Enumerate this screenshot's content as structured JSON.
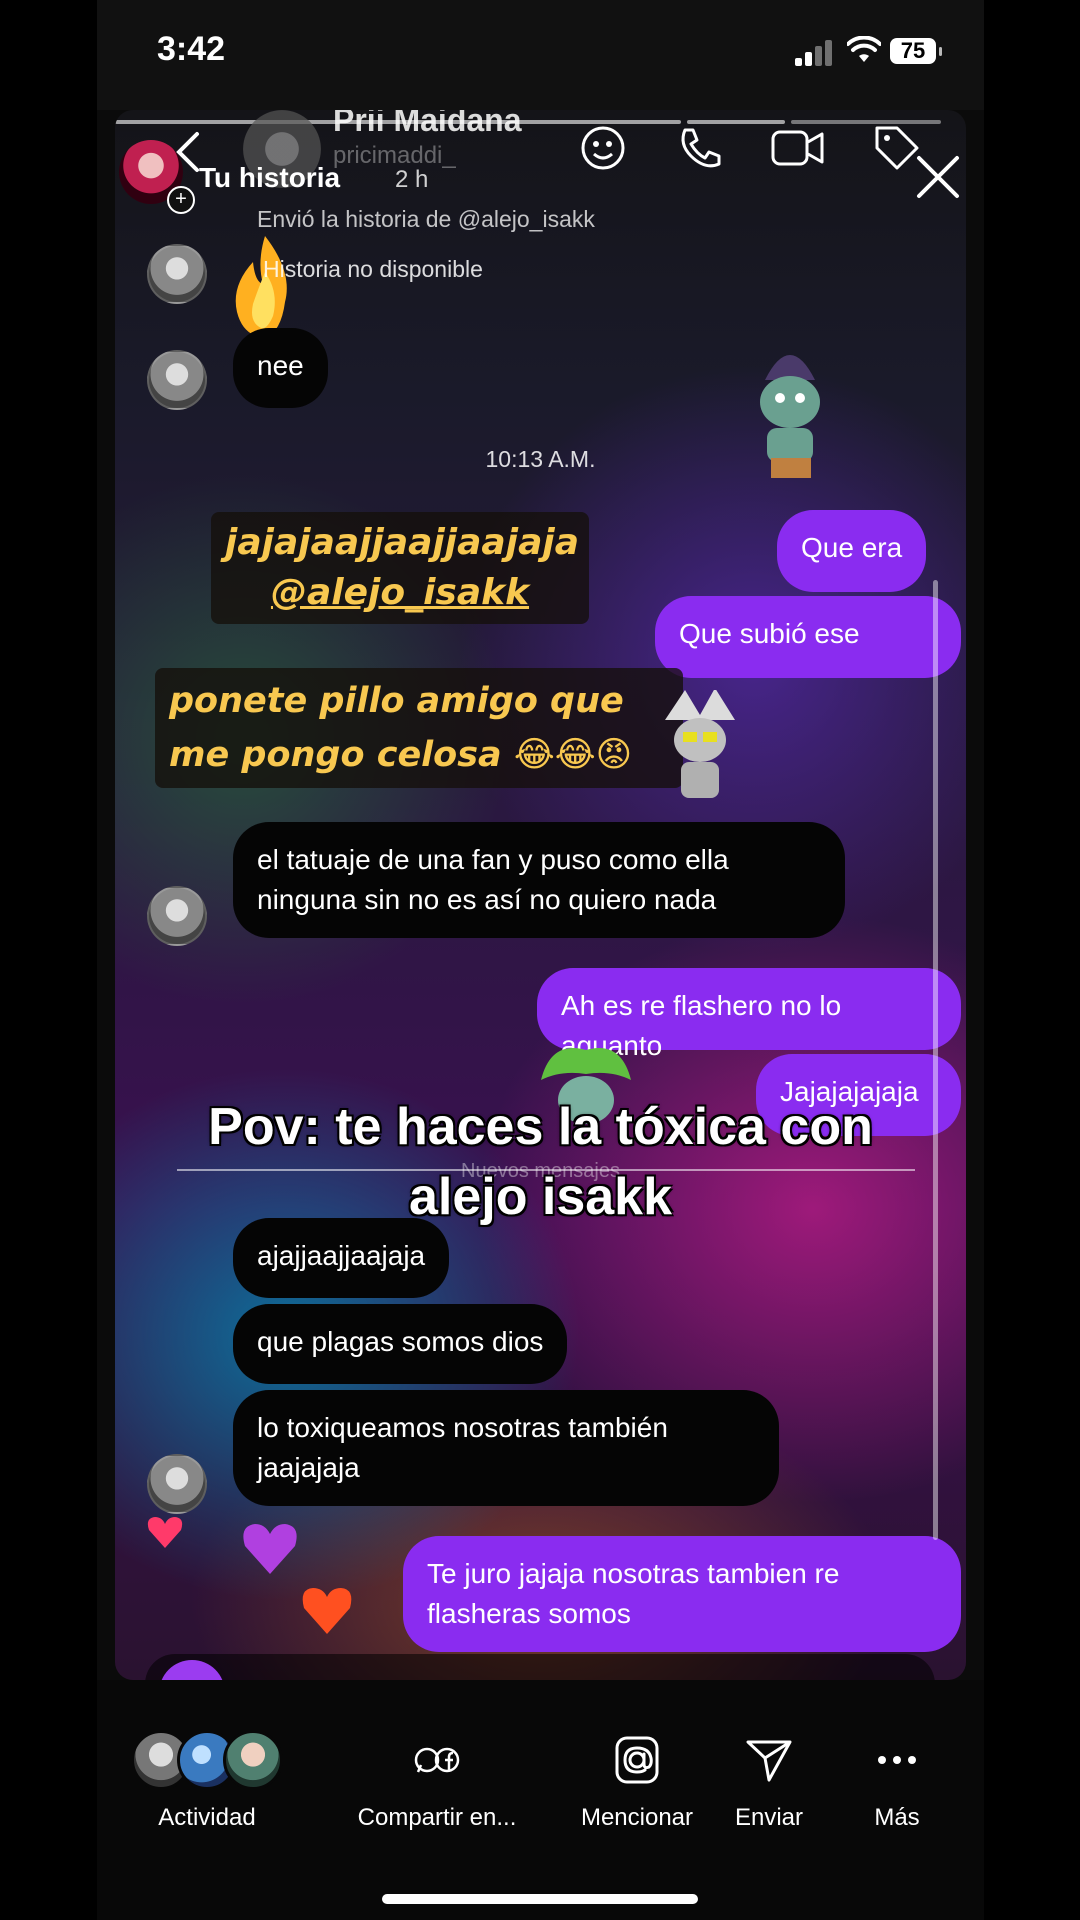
{
  "status": {
    "time": "3:42",
    "battery": "75"
  },
  "chat_header": {
    "name": "Prii Maidana",
    "username": "pricimaddi_"
  },
  "story_header": {
    "label": "Tu historia",
    "age": "2 h"
  },
  "chat": {
    "shared_note": "Envió la historia de @alejo_isakk",
    "unavailable": "Historia no disponible",
    "msg_nee": "nee",
    "timestamp": "10:13 A.M.",
    "out_1": "Que era",
    "out_2": "Que subió ese",
    "in_tattoo_1": "el tatuaje de una fan y puso como ella",
    "in_tattoo_2": "ninguna sin no es así no quiero nada",
    "out_3": "Ah es re flashero no lo aguanto",
    "out_4": "Jajajajajaja",
    "new_messages": "Nuevos mensajes",
    "in_a": "ajajjaajjaajaja",
    "in_b": "que plagas somos dios",
    "in_c_1": "lo toxiqueamos nosotras también",
    "in_c_2": "jaajajaja",
    "out_5_1": "Te juro jajaja nosotras tambien re",
    "out_5_2": "flasheras somos"
  },
  "stickers": {
    "laugh_line_1": "jajajaajjaajjaajaja",
    "laugh_line_2": "@alejo_isakk",
    "jealous_line_1": "ponete pillo amigo que",
    "jealous_line_2": "me pongo celosa 😂😂😡"
  },
  "overlay": {
    "line_1": "Pov: te haces la tóxica con",
    "line_2": "alejo isakk"
  },
  "actions": [
    {
      "label": "Actividad",
      "icon": "avatars"
    },
    {
      "label": "Compartir en...",
      "icon": "share-apps-icon"
    },
    {
      "label": "Mencionar",
      "icon": "at-icon"
    },
    {
      "label": "Enviar",
      "icon": "send-icon"
    },
    {
      "label": "Más",
      "icon": "more-icon"
    }
  ],
  "colors": {
    "outgoing_bubble": "#8a2cf0",
    "incoming_bubble": "#050505",
    "sticker_text": "#f8c850"
  }
}
